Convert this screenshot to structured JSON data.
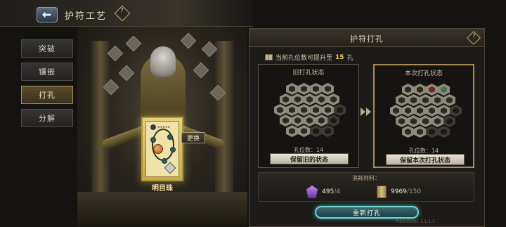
{
  "header": {
    "title": "护符工艺",
    "help": "?"
  },
  "menu": {
    "items": [
      {
        "label": "突破"
      },
      {
        "label": "镶嵌"
      },
      {
        "label": "打孔"
      },
      {
        "label": "分解"
      }
    ],
    "active": "打孔"
  },
  "item": {
    "name": "明目珠",
    "replace_label": "更换"
  },
  "panel": {
    "title": "护符打孔",
    "help": "?",
    "info_prefix": "当前孔位数可提升至",
    "info_value": "15",
    "info_suffix": "孔",
    "old_state": {
      "title": "旧打孔状态",
      "hole_count": "孔位数：14",
      "button": "保留旧的状态"
    },
    "new_state": {
      "title": "本次打孔状态",
      "hole_count": "孔位数：14",
      "button": "保留本次打孔状态"
    },
    "cost": {
      "title": "消耗材料：",
      "materials": [
        {
          "icon": "purple-crystal-icon",
          "have": "495",
          "need": "/4"
        },
        {
          "icon": "scroll-icon",
          "have": "9969",
          "need": "/150"
        }
      ]
    },
    "redo_button": "重新打孔",
    "pid": "PID265585  1.1.1.1"
  },
  "colors": {
    "accent": "#a88e55",
    "button_glow": "#6fd6d6",
    "highlight_number": "#f1c550"
  }
}
